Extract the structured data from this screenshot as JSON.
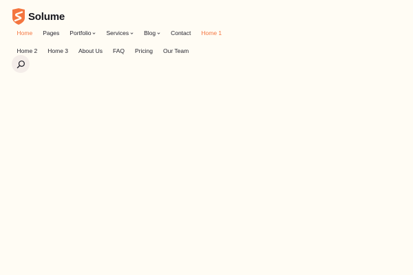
{
  "brand": {
    "name": "Solume",
    "accent_color": "#f4753f",
    "icon": "shield-s-logo-icon"
  },
  "nav": {
    "items": [
      {
        "label": "Home",
        "active": true
      },
      {
        "label": "Pages"
      },
      {
        "label": "Portfolio",
        "has_dropdown": true
      },
      {
        "label": "Services",
        "has_dropdown": true
      },
      {
        "label": "Blog",
        "has_dropdown": true
      },
      {
        "label": "Contact"
      },
      {
        "label": "Home 1",
        "active": true
      },
      {
        "label": "Home 2"
      },
      {
        "label": "Home 3"
      },
      {
        "label": "About Us"
      },
      {
        "label": "FAQ"
      },
      {
        "label": "Pricing"
      },
      {
        "label": "Our Team"
      }
    ]
  },
  "search": {
    "icon": "search-icon"
  }
}
